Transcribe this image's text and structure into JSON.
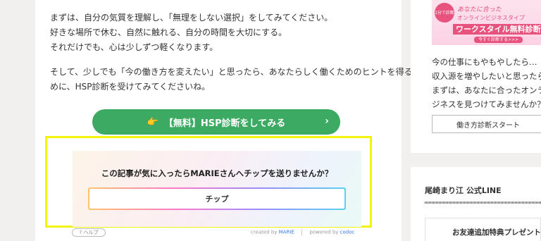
{
  "article": {
    "para1": [
      "まずは、自分の気質を理解し、「無理をしない選択」をしてみてください。",
      "好きな場所で休む、自然に触れる、自分の時間を大切にする。",
      "それだけでも、心は少しずつ軽くなります。"
    ],
    "para2": [
      "そして、少しでも「今の働き方を変えたい」と思ったら、あなたらしく働くためのヒントを得るた",
      "めに、HSP診断を受けてみてくださいね。"
    ],
    "cta_label": "【無料】HSP診断をしてみる",
    "cta_hand_icon": "👉",
    "cta_chevron": "›"
  },
  "tip": {
    "question": "この記事が気に入ったらMARIEさんへチップを送りませんか？",
    "button_label": "チップ",
    "help_label": "? ヘルプ",
    "created_by_prefix": "created by",
    "created_by_name": "MARIE",
    "powered_by_prefix": "powered by",
    "powered_by_name": "codoc"
  },
  "sidebar": {
    "banner": {
      "circle": "1分で診断",
      "line1": "あなたに合った",
      "line2": "オンラインビジネスタイプ",
      "line3": "ワークスタイル無料診断",
      "line4": "今すぐ診断する>>>"
    },
    "text": [
      "今の仕事にもやもやしたら…",
      "収入源を増やしたいと思ったら",
      "まずは、あなたに合ったオンライ",
      "ジネスを見つけてみませんか？"
    ],
    "button_label": "働き方診断スタート",
    "line_title": "尾崎まり江 公式LINE",
    "line_card_title": "お友達追加特典プレゼント"
  },
  "colors": {
    "cta": "#3daa63",
    "highlight_border": "#f6f30a",
    "banner_pink": "#e8527f"
  }
}
